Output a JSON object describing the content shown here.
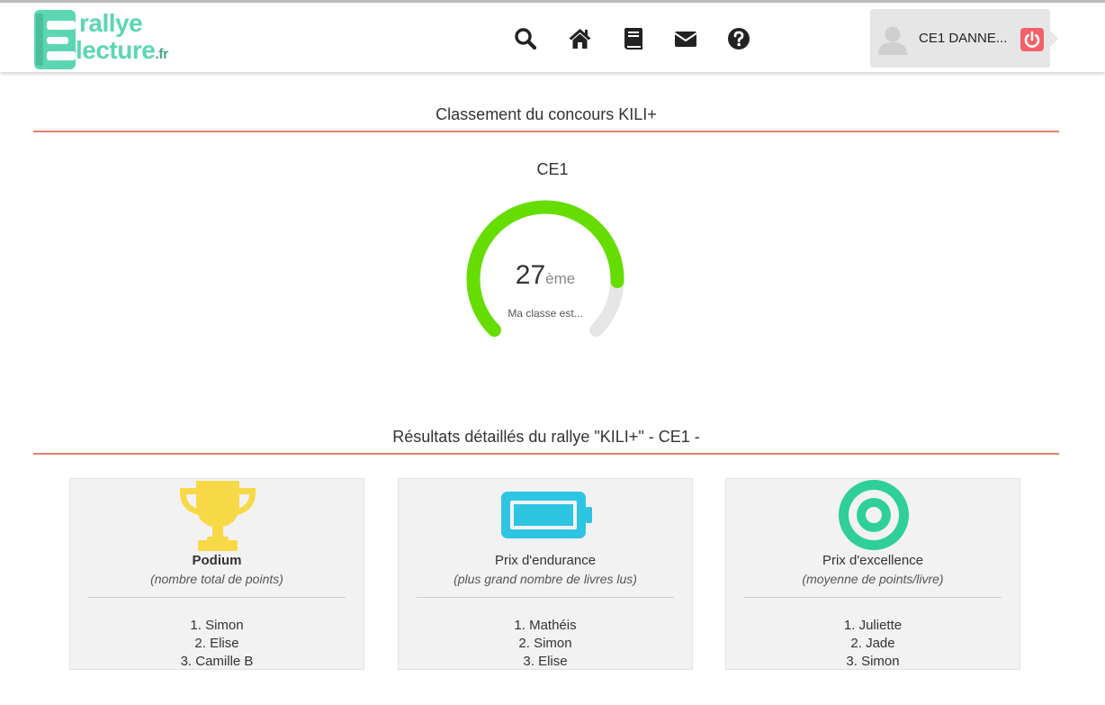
{
  "header": {
    "logo": {
      "line1": "rallye",
      "line2": "lecture",
      "tld": ".fr"
    },
    "nav": [
      {
        "icon": "search-icon"
      },
      {
        "icon": "home-icon"
      },
      {
        "icon": "book-icon"
      },
      {
        "icon": "envelope-icon"
      },
      {
        "icon": "help-icon"
      }
    ],
    "user": {
      "name": "CE1 DANNE...",
      "avatar_icon": "user-avatar-icon",
      "logout_icon": "power-icon"
    }
  },
  "ranking": {
    "title": "Classement du concours KILI+",
    "class_label": "CE1",
    "rank": "27",
    "rank_suffix": "ème",
    "caption": "Ma classe est...",
    "gauge_fill_fraction": 0.84,
    "gauge_color": "#66dd00",
    "gauge_track_color": "#e6e6e6"
  },
  "results": {
    "title": "Résultats détaillés du rallye \"KILI+\" - CE1 -",
    "cards": [
      {
        "icon": "trophy-icon",
        "title": "Podium",
        "subtitle": "(nombre total de points)",
        "entries": [
          "1. Simon",
          "2. Elise",
          "3. Camille B"
        ]
      },
      {
        "icon": "battery-icon",
        "title": "Prix d'endurance",
        "subtitle": "(plus grand nombre de livres lus)",
        "entries": [
          "1. Mathéis",
          "2. Simon",
          "3. Elise"
        ]
      },
      {
        "icon": "target-icon",
        "title": "Prix d'excellence",
        "subtitle": "(moyenne de points/livre)",
        "entries": [
          "1. Juliette",
          "2. Jade",
          "3. Simon"
        ]
      }
    ]
  },
  "colors": {
    "accent": "#5cd6b2",
    "rule": "#e2826e",
    "trophy": "#f7d948",
    "battery": "#2ec5e3",
    "target": "#2fcf99",
    "logout": "#f0616a"
  }
}
